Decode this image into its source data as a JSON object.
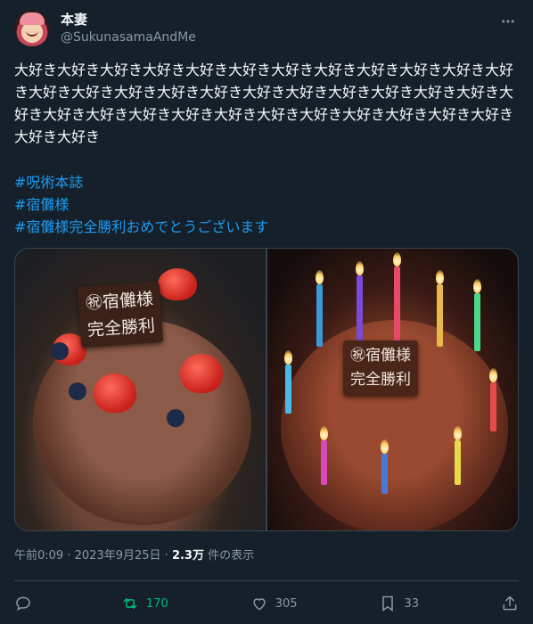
{
  "user": {
    "display_name": "本妻",
    "handle": "@SukunasamaAndMe"
  },
  "tweet": {
    "text": "大好き大好き大好き大好き大好き大好き大好き大好き大好き大好き大好き大好き大好き大好き大好き大好き大好き大好き大好き大好き大好き大好き大好き大好き大好き大好き大好き大好き大好き大好き大好き大好き大好き大好き大好き大好き大好き",
    "hashtags": [
      "#呪術本誌",
      "#宿儺様",
      "#宿儺様完全勝利おめでとうございます"
    ]
  },
  "media": {
    "photo_1_plaque_line_1": "㊗宿儺様",
    "photo_1_plaque_line_2": "完全勝利",
    "photo_2_plaque_line_1": "㊗宿儺様",
    "photo_2_plaque_line_2": "完全勝利"
  },
  "meta": {
    "time": "午前0:09",
    "separator_1": "·",
    "date": "2023年9月25日",
    "separator_2": "·",
    "view_count": "2.3万",
    "view_label": "件の表示"
  },
  "actions": {
    "reply_count": "",
    "retweet_count": "170",
    "like_count": "305",
    "bookmark_count": "33"
  },
  "colors": {
    "background": "#15202b",
    "text": "#f7f9f9",
    "secondary": "#8b98a5",
    "link": "#1d9bf0",
    "retweet": "#00ba7c",
    "border": "#38444d"
  },
  "icons": {
    "more": "more-icon",
    "reply": "reply-icon",
    "retweet": "retweet-icon",
    "like": "heart-icon",
    "bookmark": "bookmark-icon",
    "share": "share-icon"
  }
}
